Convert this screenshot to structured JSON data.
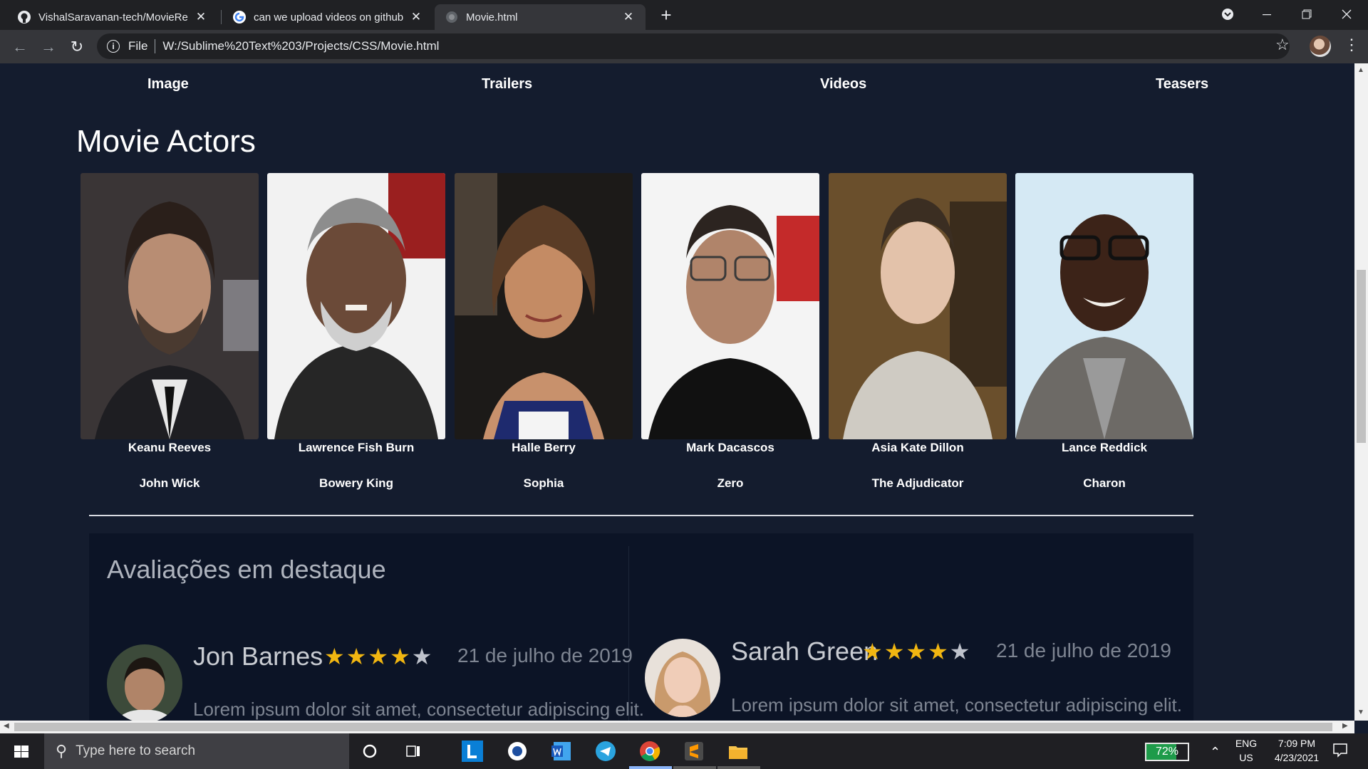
{
  "browser": {
    "tabs": [
      {
        "title": "VishalSaravanan-tech/MovieRepo",
        "favicon": "github-icon",
        "active": false
      },
      {
        "title": "can we upload videos on github",
        "favicon": "google-icon",
        "active": false
      },
      {
        "title": "Movie.html",
        "favicon": "globe-icon",
        "active": true
      }
    ],
    "address": {
      "scheme": "File",
      "url": "W:/Sublime%20Text%203/Projects/CSS/Movie.html"
    }
  },
  "page": {
    "media_nav": [
      "Image",
      "Trailers",
      "Videos",
      "Teasers"
    ],
    "actors_title": "Movie Actors",
    "actors": [
      {
        "name": "Keanu Reeves",
        "role": "John Wick"
      },
      {
        "name": "Lawrence Fish Burn",
        "role": "Bowery King"
      },
      {
        "name": "Halle Berry",
        "role": "Sophia"
      },
      {
        "name": "Mark Dacascos",
        "role": "Zero"
      },
      {
        "name": "Asia Kate Dillon",
        "role": "The Adjudicator"
      },
      {
        "name": "Lance Reddick",
        "role": "Charon"
      }
    ],
    "reviews": {
      "heading": "Avaliações em destaque",
      "items": [
        {
          "name": "Jon Barnes",
          "stars": 4,
          "date": "21 de julho de 2019",
          "text": "Lorem ipsum dolor sit amet, consectetur adipiscing elit."
        },
        {
          "name": "Sarah Green",
          "stars": 4,
          "date": "21 de julho de 2019",
          "text": "Lorem ipsum dolor sit amet, consectetur adipiscing elit."
        }
      ]
    }
  },
  "taskbar": {
    "search_placeholder": "Type here to search",
    "battery": "72%",
    "battery_level": 0.72,
    "lang": "ENG",
    "region": "US",
    "time": "7:09 PM",
    "date": "4/23/2021"
  }
}
